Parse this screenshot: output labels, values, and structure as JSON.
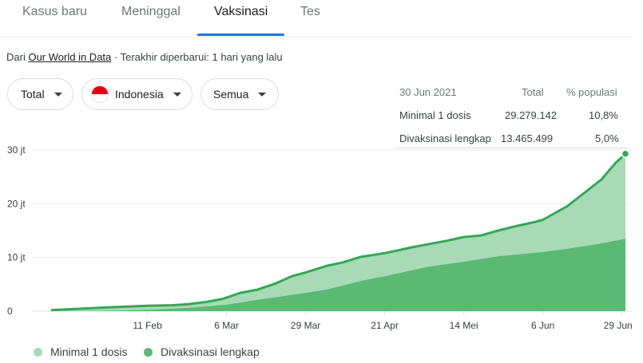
{
  "tabs": [
    "Kasus baru",
    "Meninggal",
    "Vaksinasi",
    "Tes"
  ],
  "active_tab": "Vaksinasi",
  "source": {
    "prefix": "Dari",
    "link": "Our World in Data",
    "suffix": "· Terakhir diperbarui: 1 hari yang lalu"
  },
  "filters": {
    "metric": "Total",
    "country": "Indonesia",
    "scope": "Semua"
  },
  "stats": {
    "date": "30 Jun 2021",
    "col_total": "Total",
    "col_percent": "% populasi",
    "rows": [
      {
        "label": "Minimal 1 dosis",
        "total": "29.279.142",
        "percent": "10,8%"
      },
      {
        "label": "Divaksinasi lengkap",
        "total": "13.465.499",
        "percent": "5,0%"
      }
    ]
  },
  "colors": {
    "tab_accent": "#1a73e8",
    "line": "#34a853",
    "area_light": "#a8dab5",
    "area_dark": "#5bb974",
    "grid": "#ebebeb",
    "flag_red": "#e70011"
  },
  "chart_data": {
    "type": "area",
    "y_ticks": [
      "0",
      "10 jt",
      "20 jt",
      "30 jt"
    ],
    "y_tick_values": [
      0,
      10,
      20,
      30
    ],
    "ylim": [
      0,
      30
    ],
    "x_tick_labels": [
      "11 Feb",
      "6 Mar",
      "29 Mar",
      "21 Apr",
      "14 Mei",
      "6 Jun",
      "29 Jun"
    ],
    "x_tick_days": [
      28,
      51,
      74,
      97,
      120,
      143,
      166
    ],
    "x_range_days": [
      0,
      167
    ],
    "series": [
      {
        "name": "Minimal 1 dosis",
        "points": [
          [
            0,
            0.2
          ],
          [
            10,
            0.5
          ],
          [
            20,
            0.8
          ],
          [
            28,
            1.0
          ],
          [
            35,
            1.1
          ],
          [
            40,
            1.3
          ],
          [
            45,
            1.7
          ],
          [
            50,
            2.3
          ],
          [
            55,
            3.4
          ],
          [
            60,
            4.0
          ],
          [
            65,
            5.1
          ],
          [
            70,
            6.5
          ],
          [
            74,
            7.2
          ],
          [
            80,
            8.4
          ],
          [
            85,
            9.1
          ],
          [
            90,
            10.1
          ],
          [
            97,
            10.8
          ],
          [
            100,
            11.2
          ],
          [
            105,
            11.9
          ],
          [
            110,
            12.5
          ],
          [
            115,
            13.1
          ],
          [
            120,
            13.8
          ],
          [
            125,
            14.1
          ],
          [
            130,
            15.0
          ],
          [
            135,
            15.8
          ],
          [
            140,
            16.5
          ],
          [
            143,
            17.0
          ],
          [
            150,
            19.5
          ],
          [
            155,
            22.0
          ],
          [
            160,
            24.5
          ],
          [
            164,
            27.5
          ],
          [
            167,
            29.3
          ]
        ]
      },
      {
        "name": "Divaksinasi lengkap",
        "points": [
          [
            0,
            0
          ],
          [
            20,
            0.1
          ],
          [
            30,
            0.3
          ],
          [
            40,
            0.6
          ],
          [
            51,
            1.2
          ],
          [
            60,
            2.1
          ],
          [
            70,
            3.0
          ],
          [
            74,
            3.4
          ],
          [
            80,
            4.0
          ],
          [
            85,
            4.8
          ],
          [
            90,
            5.6
          ],
          [
            97,
            6.5
          ],
          [
            105,
            7.6
          ],
          [
            110,
            8.3
          ],
          [
            120,
            9.2
          ],
          [
            130,
            10.2
          ],
          [
            143,
            11.0
          ],
          [
            150,
            11.6
          ],
          [
            160,
            12.6
          ],
          [
            167,
            13.5
          ]
        ]
      }
    ]
  }
}
